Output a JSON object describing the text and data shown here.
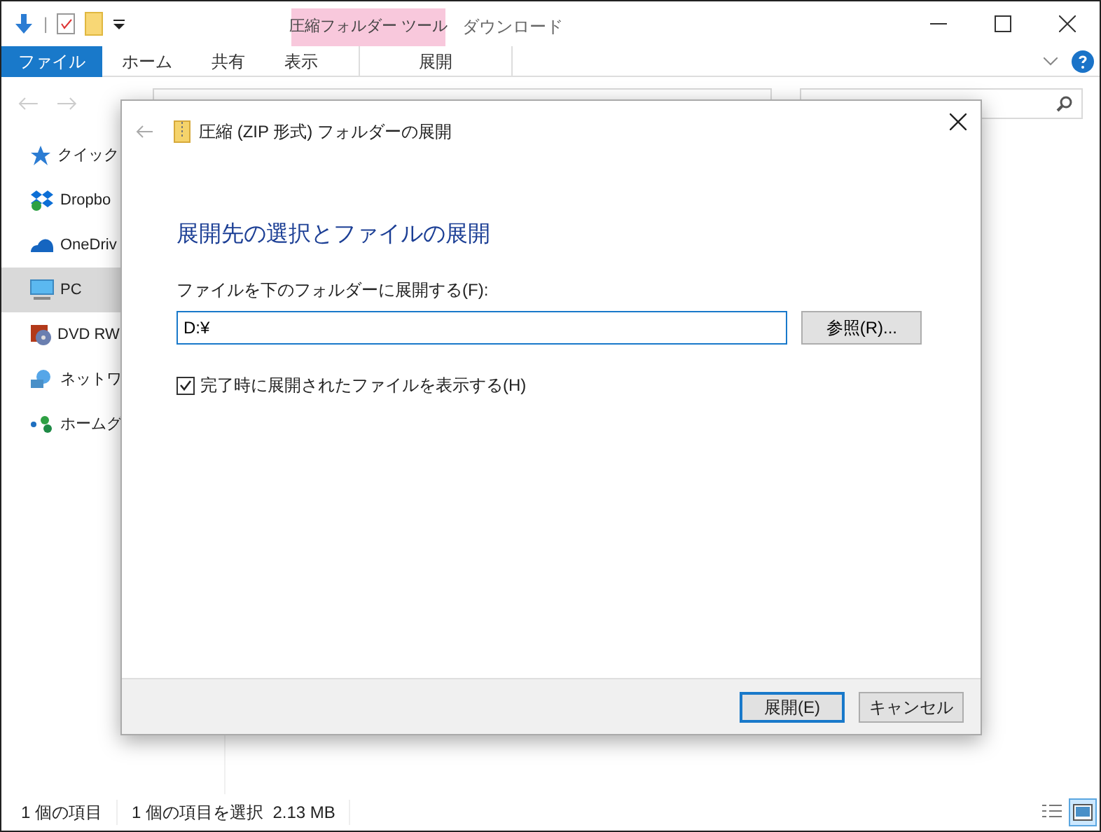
{
  "quick_access_toolbar": {
    "separator": "|"
  },
  "context_tab_group": {
    "label": "圧縮フォルダー ツール"
  },
  "window": {
    "title": "ダウンロード"
  },
  "ribbon_tabs": [
    {
      "label": "ファイル",
      "selected": false,
      "kind": "file"
    },
    {
      "label": "ホーム",
      "selected": false,
      "kind": "tab"
    },
    {
      "label": "共有",
      "selected": false,
      "kind": "tab"
    },
    {
      "label": "表示",
      "selected": false,
      "kind": "tab"
    },
    {
      "label": "展開",
      "selected": false,
      "kind": "context"
    }
  ],
  "sidebar": {
    "items": [
      {
        "label": "クイック",
        "selected": false
      },
      {
        "label": "Dropbo",
        "selected": false
      },
      {
        "label": "OneDriv",
        "selected": false
      },
      {
        "label": "PC",
        "selected": true
      },
      {
        "label": "DVD RW",
        "selected": false
      },
      {
        "label": "ネットワ",
        "selected": false
      },
      {
        "label": "ホームグ",
        "selected": false
      }
    ]
  },
  "status_bar": {
    "item_count": "1 個の項目",
    "selection": "1 個の項目を選択  2.13 MB"
  },
  "dialog": {
    "title": "圧縮 (ZIP 形式) フォルダーの展開",
    "heading": "展開先の選択とファイルの展開",
    "field_label": "ファイルを下のフォルダーに展開する(F):",
    "path": "D:¥",
    "browse_button": "参照(R)...",
    "show_files": {
      "label": "完了時に展開されたファイルを表示する(H)",
      "checked": true
    },
    "buttons": [
      {
        "label": "展開(E)",
        "default": true
      },
      {
        "label": "キャンセル",
        "default": false
      }
    ]
  }
}
